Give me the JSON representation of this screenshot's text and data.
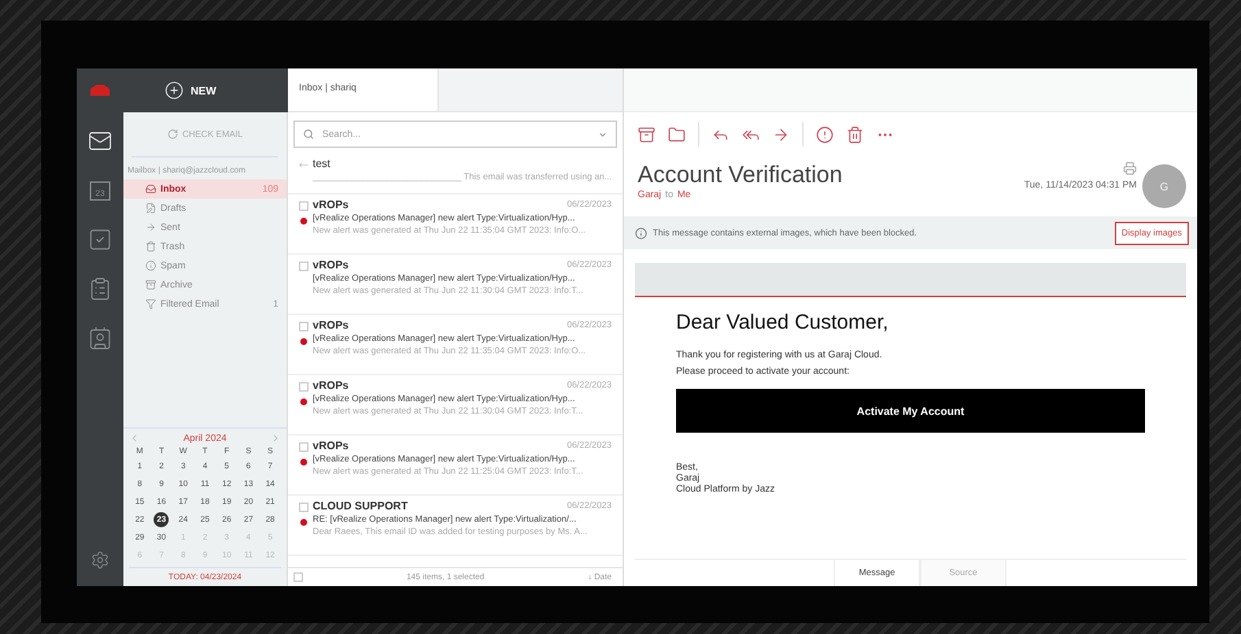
{
  "header": {
    "new_label": "NEW"
  },
  "rail": [
    {
      "kind": "mail",
      "selected": true
    },
    {
      "kind": "calendar",
      "day": "23",
      "selected": false
    },
    {
      "kind": "tasks",
      "selected": false
    },
    {
      "kind": "notes",
      "selected": false
    },
    {
      "kind": "contacts",
      "selected": false
    }
  ],
  "folders": {
    "check_email": "CHECK EMAIL",
    "mailbox": "Mailbox | shariq@jazzcloud.com",
    "items": [
      {
        "kind": "inbox",
        "label": "Inbox",
        "count": "109",
        "selected": true
      },
      {
        "kind": "drafts",
        "label": "Drafts",
        "selected": false
      },
      {
        "kind": "sent",
        "label": "Sent",
        "selected": false
      },
      {
        "kind": "trash",
        "label": "Trash",
        "selected": false
      },
      {
        "kind": "spam",
        "label": "Spam",
        "selected": false
      },
      {
        "kind": "archive",
        "label": "Archive",
        "selected": false
      },
      {
        "kind": "filter",
        "label": "Filtered Email",
        "count": "1",
        "selected": false
      }
    ]
  },
  "calendar": {
    "month": "April 2024",
    "weekdays": [
      "M",
      "T",
      "W",
      "T",
      "F",
      "S",
      "S"
    ],
    "days": [
      {
        "label": "1",
        "muted": false,
        "selected": false
      },
      {
        "label": "2",
        "muted": false,
        "selected": false
      },
      {
        "label": "3",
        "muted": false,
        "selected": false
      },
      {
        "label": "4",
        "muted": false,
        "selected": false
      },
      {
        "label": "5",
        "muted": false,
        "selected": false
      },
      {
        "label": "6",
        "muted": false,
        "selected": false
      },
      {
        "label": "7",
        "muted": false,
        "selected": false
      },
      {
        "label": "8",
        "muted": false,
        "selected": false
      },
      {
        "label": "9",
        "muted": false,
        "selected": false
      },
      {
        "label": "10",
        "muted": false,
        "selected": false
      },
      {
        "label": "11",
        "muted": false,
        "selected": false
      },
      {
        "label": "12",
        "muted": false,
        "selected": false
      },
      {
        "label": "13",
        "muted": false,
        "selected": false
      },
      {
        "label": "14",
        "muted": false,
        "selected": false
      },
      {
        "label": "15",
        "muted": false,
        "selected": false
      },
      {
        "label": "16",
        "muted": false,
        "selected": false
      },
      {
        "label": "17",
        "muted": false,
        "selected": false
      },
      {
        "label": "18",
        "muted": false,
        "selected": false
      },
      {
        "label": "19",
        "muted": false,
        "selected": false
      },
      {
        "label": "20",
        "muted": false,
        "selected": false
      },
      {
        "label": "21",
        "muted": false,
        "selected": false
      },
      {
        "label": "22",
        "muted": false,
        "selected": false
      },
      {
        "label": "23",
        "muted": false,
        "selected": true
      },
      {
        "label": "24",
        "muted": false,
        "selected": false
      },
      {
        "label": "25",
        "muted": false,
        "selected": false
      },
      {
        "label": "26",
        "muted": false,
        "selected": false
      },
      {
        "label": "27",
        "muted": false,
        "selected": false
      },
      {
        "label": "28",
        "muted": false,
        "selected": false
      },
      {
        "label": "29",
        "muted": false,
        "selected": false
      },
      {
        "label": "30",
        "muted": false,
        "selected": false
      },
      {
        "label": "1",
        "muted": true,
        "selected": false
      },
      {
        "label": "2",
        "muted": true,
        "selected": false
      },
      {
        "label": "3",
        "muted": true,
        "selected": false
      },
      {
        "label": "4",
        "muted": true,
        "selected": false
      },
      {
        "label": "5",
        "muted": true,
        "selected": false
      },
      {
        "label": "6",
        "muted": true,
        "selected": false
      },
      {
        "label": "7",
        "muted": true,
        "selected": false
      },
      {
        "label": "8",
        "muted": true,
        "selected": false
      },
      {
        "label": "9",
        "muted": true,
        "selected": false
      },
      {
        "label": "10",
        "muted": true,
        "selected": false
      },
      {
        "label": "11",
        "muted": true,
        "selected": false
      },
      {
        "label": "12",
        "muted": true,
        "selected": false
      }
    ],
    "today": "TODAY: 04/23/2024"
  },
  "list": {
    "tab": "Inbox | shariq",
    "search_placeholder": "Search...",
    "messages": [
      {
        "kind": "replied",
        "sender": "test",
        "preview": "______________________________ This email was transferred using an..."
      },
      {
        "kind": "mail",
        "checked": false,
        "unread": true,
        "sender": "vROPs",
        "date": "06/22/2023",
        "subject": "[vRealize Operations Manager] new alert Type:Virtualization/Hyp...",
        "preview": "New alert was generated at Thu Jun 22 11:35:04 GMT 2023: Info:O..."
      },
      {
        "kind": "mail",
        "checked": false,
        "unread": false,
        "sender": "vROPs",
        "date": "06/22/2023",
        "subject": "[vRealize Operations Manager] new alert Type:Virtualization/Hyp...",
        "preview": "New alert was generated at Thu Jun 22 11:30:04 GMT 2023: Info:T..."
      },
      {
        "kind": "mail",
        "checked": false,
        "unread": true,
        "sender": "vROPs",
        "date": "06/22/2023",
        "subject": "[vRealize Operations Manager] new alert Type:Virtualization/Hyp...",
        "preview": "New alert was generated at Thu Jun 22 11:35:04 GMT 2023: Info:O..."
      },
      {
        "kind": "mail",
        "checked": false,
        "unread": true,
        "sender": "vROPs",
        "date": "06/22/2023",
        "subject": "[vRealize Operations Manager] new alert Type:Virtualization/Hyp...",
        "preview": "New alert was generated at Thu Jun 22 11:30:04 GMT 2023: Info:T..."
      },
      {
        "kind": "mail",
        "checked": false,
        "unread": true,
        "sender": "vROPs",
        "date": "06/22/2023",
        "subject": "[vRealize Operations Manager] new alert Type:Virtualization/Hyp...",
        "preview": "New alert was generated at Thu Jun 22 11:25:04 GMT 2023: Info:T..."
      },
      {
        "kind": "mail",
        "checked": false,
        "unread": true,
        "sender": "CLOUD SUPPORT",
        "date": "06/22/2023",
        "subject": "RE: [vRealize Operations Manager] new alert Type:Virtualization/...",
        "preview": "Dear Raees, This email ID was added for testing purposes by Ms. A..."
      }
    ],
    "select_all_checked": false,
    "footer_count": "145 items, 1 selected",
    "footer_sort": "↓ Date"
  },
  "reader": {
    "toolbar_groups": [
      [
        {
          "kind": "archive"
        },
        {
          "kind": "folder"
        }
      ],
      [
        {
          "kind": "reply"
        },
        {
          "kind": "reply-all"
        },
        {
          "kind": "forward"
        }
      ],
      [
        {
          "kind": "alert"
        },
        {
          "kind": "trash"
        },
        {
          "kind": "more"
        }
      ]
    ],
    "subject": "Account Verification",
    "from": "Garaj",
    "to_word": "to",
    "to": "Me",
    "date": "Tue, 11/14/2023 04:31 PM",
    "avatar": "G",
    "notice": "This message contains external images, which have been blocked.",
    "display_images": "Display images",
    "body": {
      "greeting": "Dear Valued Customer,",
      "lines": [
        "Thank you for registering with us at Garaj Cloud.",
        "Please proceed to activate your account:"
      ],
      "button": "Activate My Account",
      "signature": [
        "Best,",
        "Garaj",
        "Cloud Platform by Jazz"
      ]
    },
    "tabs": [
      {
        "label": "Message",
        "selected": true
      },
      {
        "label": "Source",
        "selected": false
      }
    ]
  }
}
